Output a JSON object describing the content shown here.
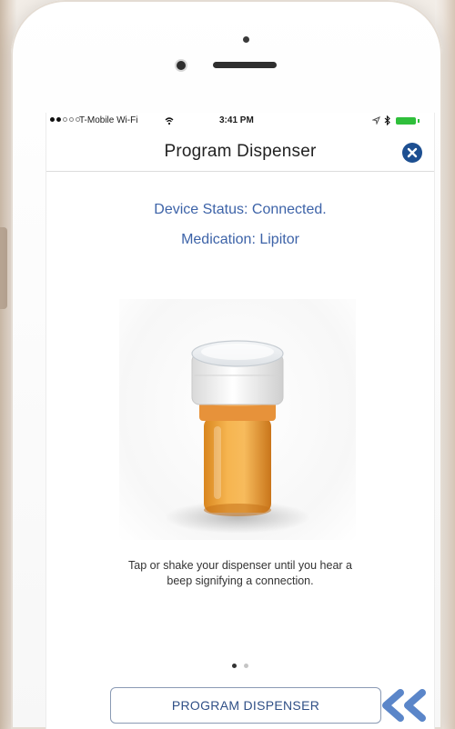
{
  "status_bar": {
    "carrier": "T-Mobile Wi-Fi",
    "time": "3:41 PM",
    "signal_bars_filled": 2,
    "signal_bars_total": 5,
    "battery_color": "#2fbf3b"
  },
  "nav": {
    "title": "Program Dispenser",
    "close_icon": "close-circle-icon"
  },
  "device_status": "Device Status: Connected.",
  "medication": "Medication: Lipitor",
  "instructions": "Tap or shake your dispenser until you hear a beep signifying a connection.",
  "pagination": {
    "current": 1,
    "total": 2
  },
  "program_button_label": "PROGRAM DISPENSER",
  "annotation_icon": "double-chevron-left-icon",
  "colors": {
    "accent_blue": "#3d63a8",
    "close_button": "#1d4f91",
    "bottle_amber": "#f0a53a"
  }
}
